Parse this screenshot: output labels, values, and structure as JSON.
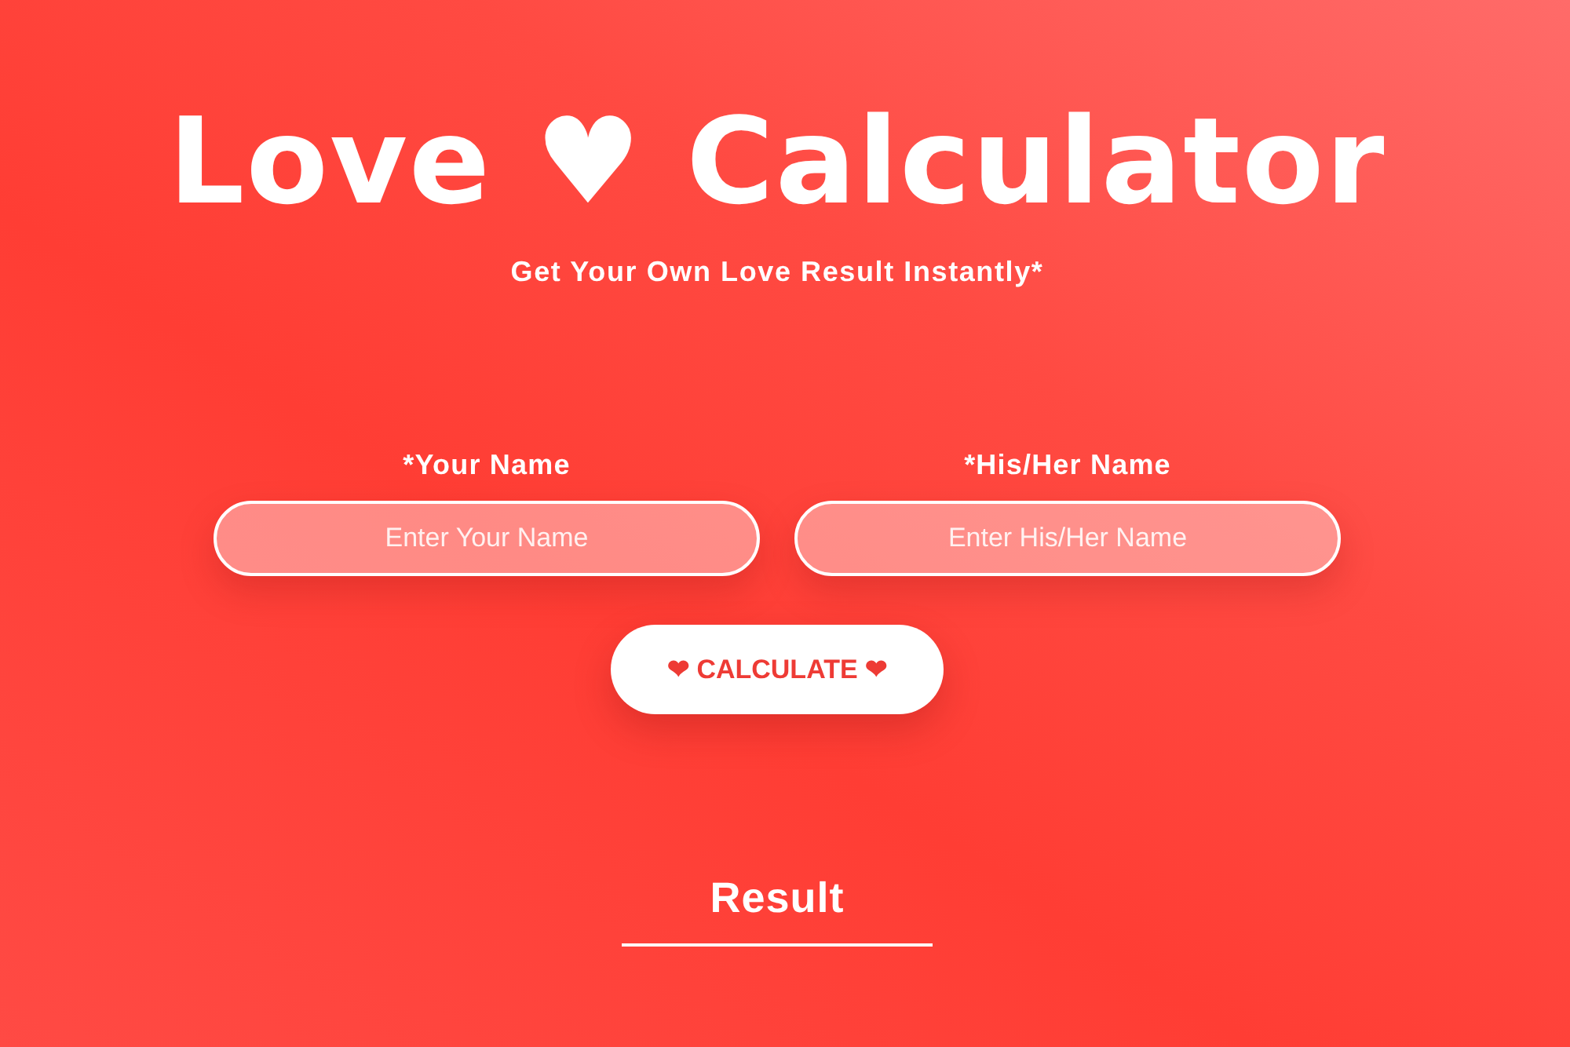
{
  "header": {
    "title": "Love ♥ Calculator",
    "subtitle": "Get Your Own Love Result Instantly*"
  },
  "form": {
    "fields": [
      {
        "label": "*Your Name",
        "placeholder": "Enter Your Name"
      },
      {
        "label": "*His/Her Name",
        "placeholder": "Enter His/Her Name"
      }
    ],
    "button": "❤ CALCULATE ❤"
  },
  "result": {
    "heading": "Result"
  }
}
